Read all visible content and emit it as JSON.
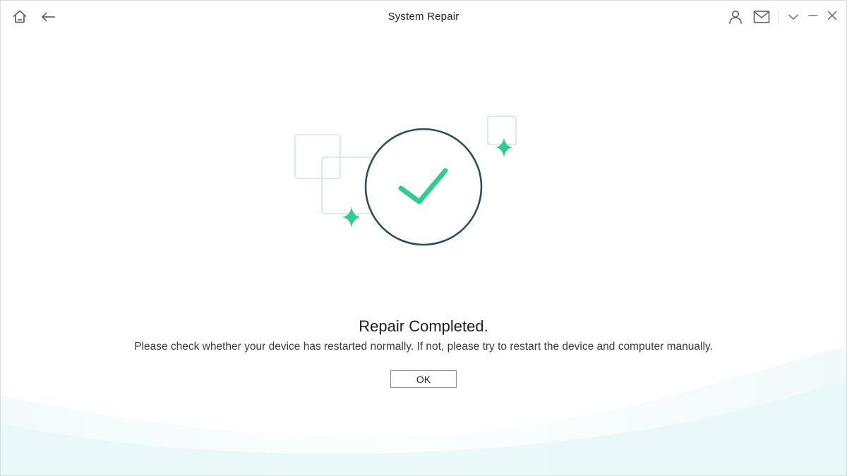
{
  "window": {
    "title": "System Repair"
  },
  "icons": {
    "home": "home-icon",
    "back": "arrow-left-icon",
    "account": "user-icon",
    "mail": "mail-icon",
    "menu": "chevron-down-icon",
    "minimize": "minimize-icon",
    "close": "close-icon",
    "success": "checkmark-circle-icon",
    "sparkle": "sparkle-icon"
  },
  "colors": {
    "accent_green": "#33cc8f",
    "circle_stroke": "#27505a",
    "frame_stroke": "#c9ebe2",
    "icon_gray": "#666666"
  },
  "result": {
    "heading": "Repair Completed.",
    "message": "Please check whether your device has restarted normally. If not, please try to restart the device and computer manually.",
    "ok_label": "OK"
  }
}
